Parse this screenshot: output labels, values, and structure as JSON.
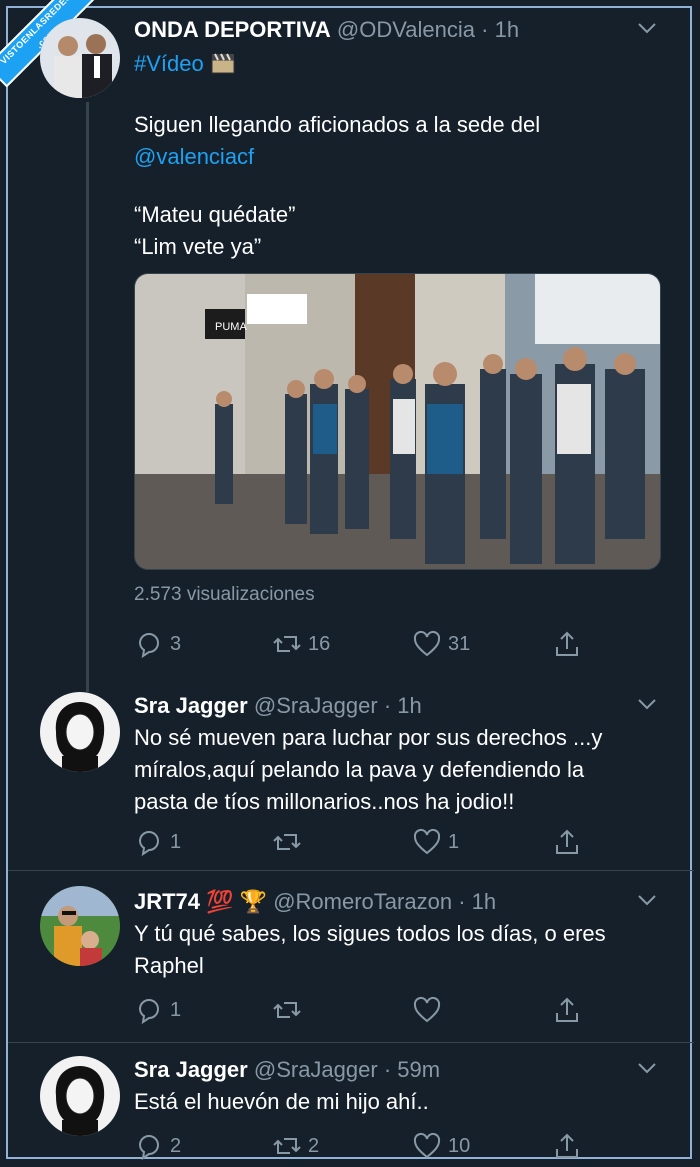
{
  "watermark": "VISTOENLASREDES .com",
  "tweets": [
    {
      "name": "ONDA DEPORTIVA",
      "handle": "@ODValencia",
      "time": "1h",
      "hashtag": "#Vídeo",
      "line1": "Siguen llegando aficionados a la sede del",
      "mention": "@valenciacf",
      "quote1": "“Mateu quédate”",
      "quote2": "“Lim vete ya”",
      "video_sign_left": "PUMA",
      "views": "2.573 visualizaciones",
      "replies": "3",
      "retweets": "16",
      "likes": "31"
    },
    {
      "name": "Sra Jagger",
      "handle": "@SraJagger",
      "time": "1h",
      "line1": "No sé mueven para luchar por sus derechos ...y",
      "line2": "míralos,aquí pelando la pava y defendiendo la",
      "line3": "pasta de tíos millonarios..nos ha jodio!!",
      "replies": "1",
      "retweets": "",
      "likes": "1"
    },
    {
      "name": "JRT74",
      "emoji": "💯 🏆",
      "handle": "@RomeroTarazon",
      "time": "1h",
      "line1": "Y tú qué sabes, los sigues todos los días, o eres",
      "line2": "Raphel",
      "replies": "1",
      "retweets": "",
      "likes": ""
    },
    {
      "name": "Sra Jagger",
      "handle": "@SraJagger",
      "time": "59m",
      "line1": "Está el huevón de mi hijo ahí..",
      "replies": "2",
      "retweets": "2",
      "likes": "10"
    }
  ],
  "colors": {
    "background": "#15202b",
    "secondary_text": "#8899a6",
    "link": "#1da1f2",
    "divider": "#38444d"
  }
}
